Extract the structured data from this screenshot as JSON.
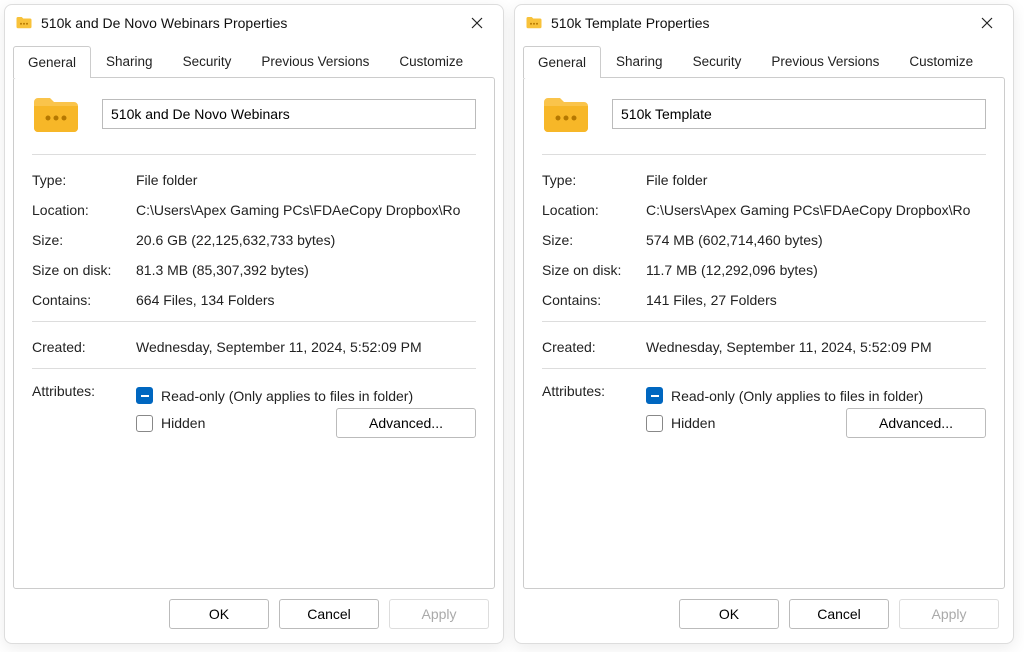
{
  "dialogs": [
    {
      "title": "510k and De Novo Webinars Properties",
      "tabs": [
        "General",
        "Sharing",
        "Security",
        "Previous Versions",
        "Customize"
      ],
      "active_tab": "General",
      "folder_name": "510k and De Novo Webinars",
      "fields": {
        "type_label": "Type:",
        "type_value": "File folder",
        "location_label": "Location:",
        "location_value": "C:\\Users\\Apex Gaming PCs\\FDAeCopy Dropbox\\Ro",
        "size_label": "Size:",
        "size_value": "20.6 GB (22,125,632,733 bytes)",
        "sod_label": "Size on disk:",
        "sod_value": "81.3 MB (85,307,392 bytes)",
        "contains_label": "Contains:",
        "contains_value": "664 Files, 134 Folders",
        "created_label": "Created:",
        "created_value": "Wednesday, September 11, 2024, 5:52:09 PM",
        "attributes_label": "Attributes:",
        "readonly_label": "Read-only (Only applies to files in folder)",
        "hidden_label": "Hidden",
        "advanced_label": "Advanced..."
      },
      "buttons": {
        "ok": "OK",
        "cancel": "Cancel",
        "apply": "Apply"
      }
    },
    {
      "title": "510k Template Properties",
      "tabs": [
        "General",
        "Sharing",
        "Security",
        "Previous Versions",
        "Customize"
      ],
      "active_tab": "General",
      "folder_name": "510k Template",
      "fields": {
        "type_label": "Type:",
        "type_value": "File folder",
        "location_label": "Location:",
        "location_value": "C:\\Users\\Apex Gaming PCs\\FDAeCopy Dropbox\\Ro",
        "size_label": "Size:",
        "size_value": "574 MB (602,714,460 bytes)",
        "sod_label": "Size on disk:",
        "sod_value": "11.7 MB (12,292,096 bytes)",
        "contains_label": "Contains:",
        "contains_value": "141 Files, 27 Folders",
        "created_label": "Created:",
        "created_value": "Wednesday, September 11, 2024, 5:52:09 PM",
        "attributes_label": "Attributes:",
        "readonly_label": "Read-only (Only applies to files in folder)",
        "hidden_label": "Hidden",
        "advanced_label": "Advanced..."
      },
      "buttons": {
        "ok": "OK",
        "cancel": "Cancel",
        "apply": "Apply"
      }
    }
  ]
}
